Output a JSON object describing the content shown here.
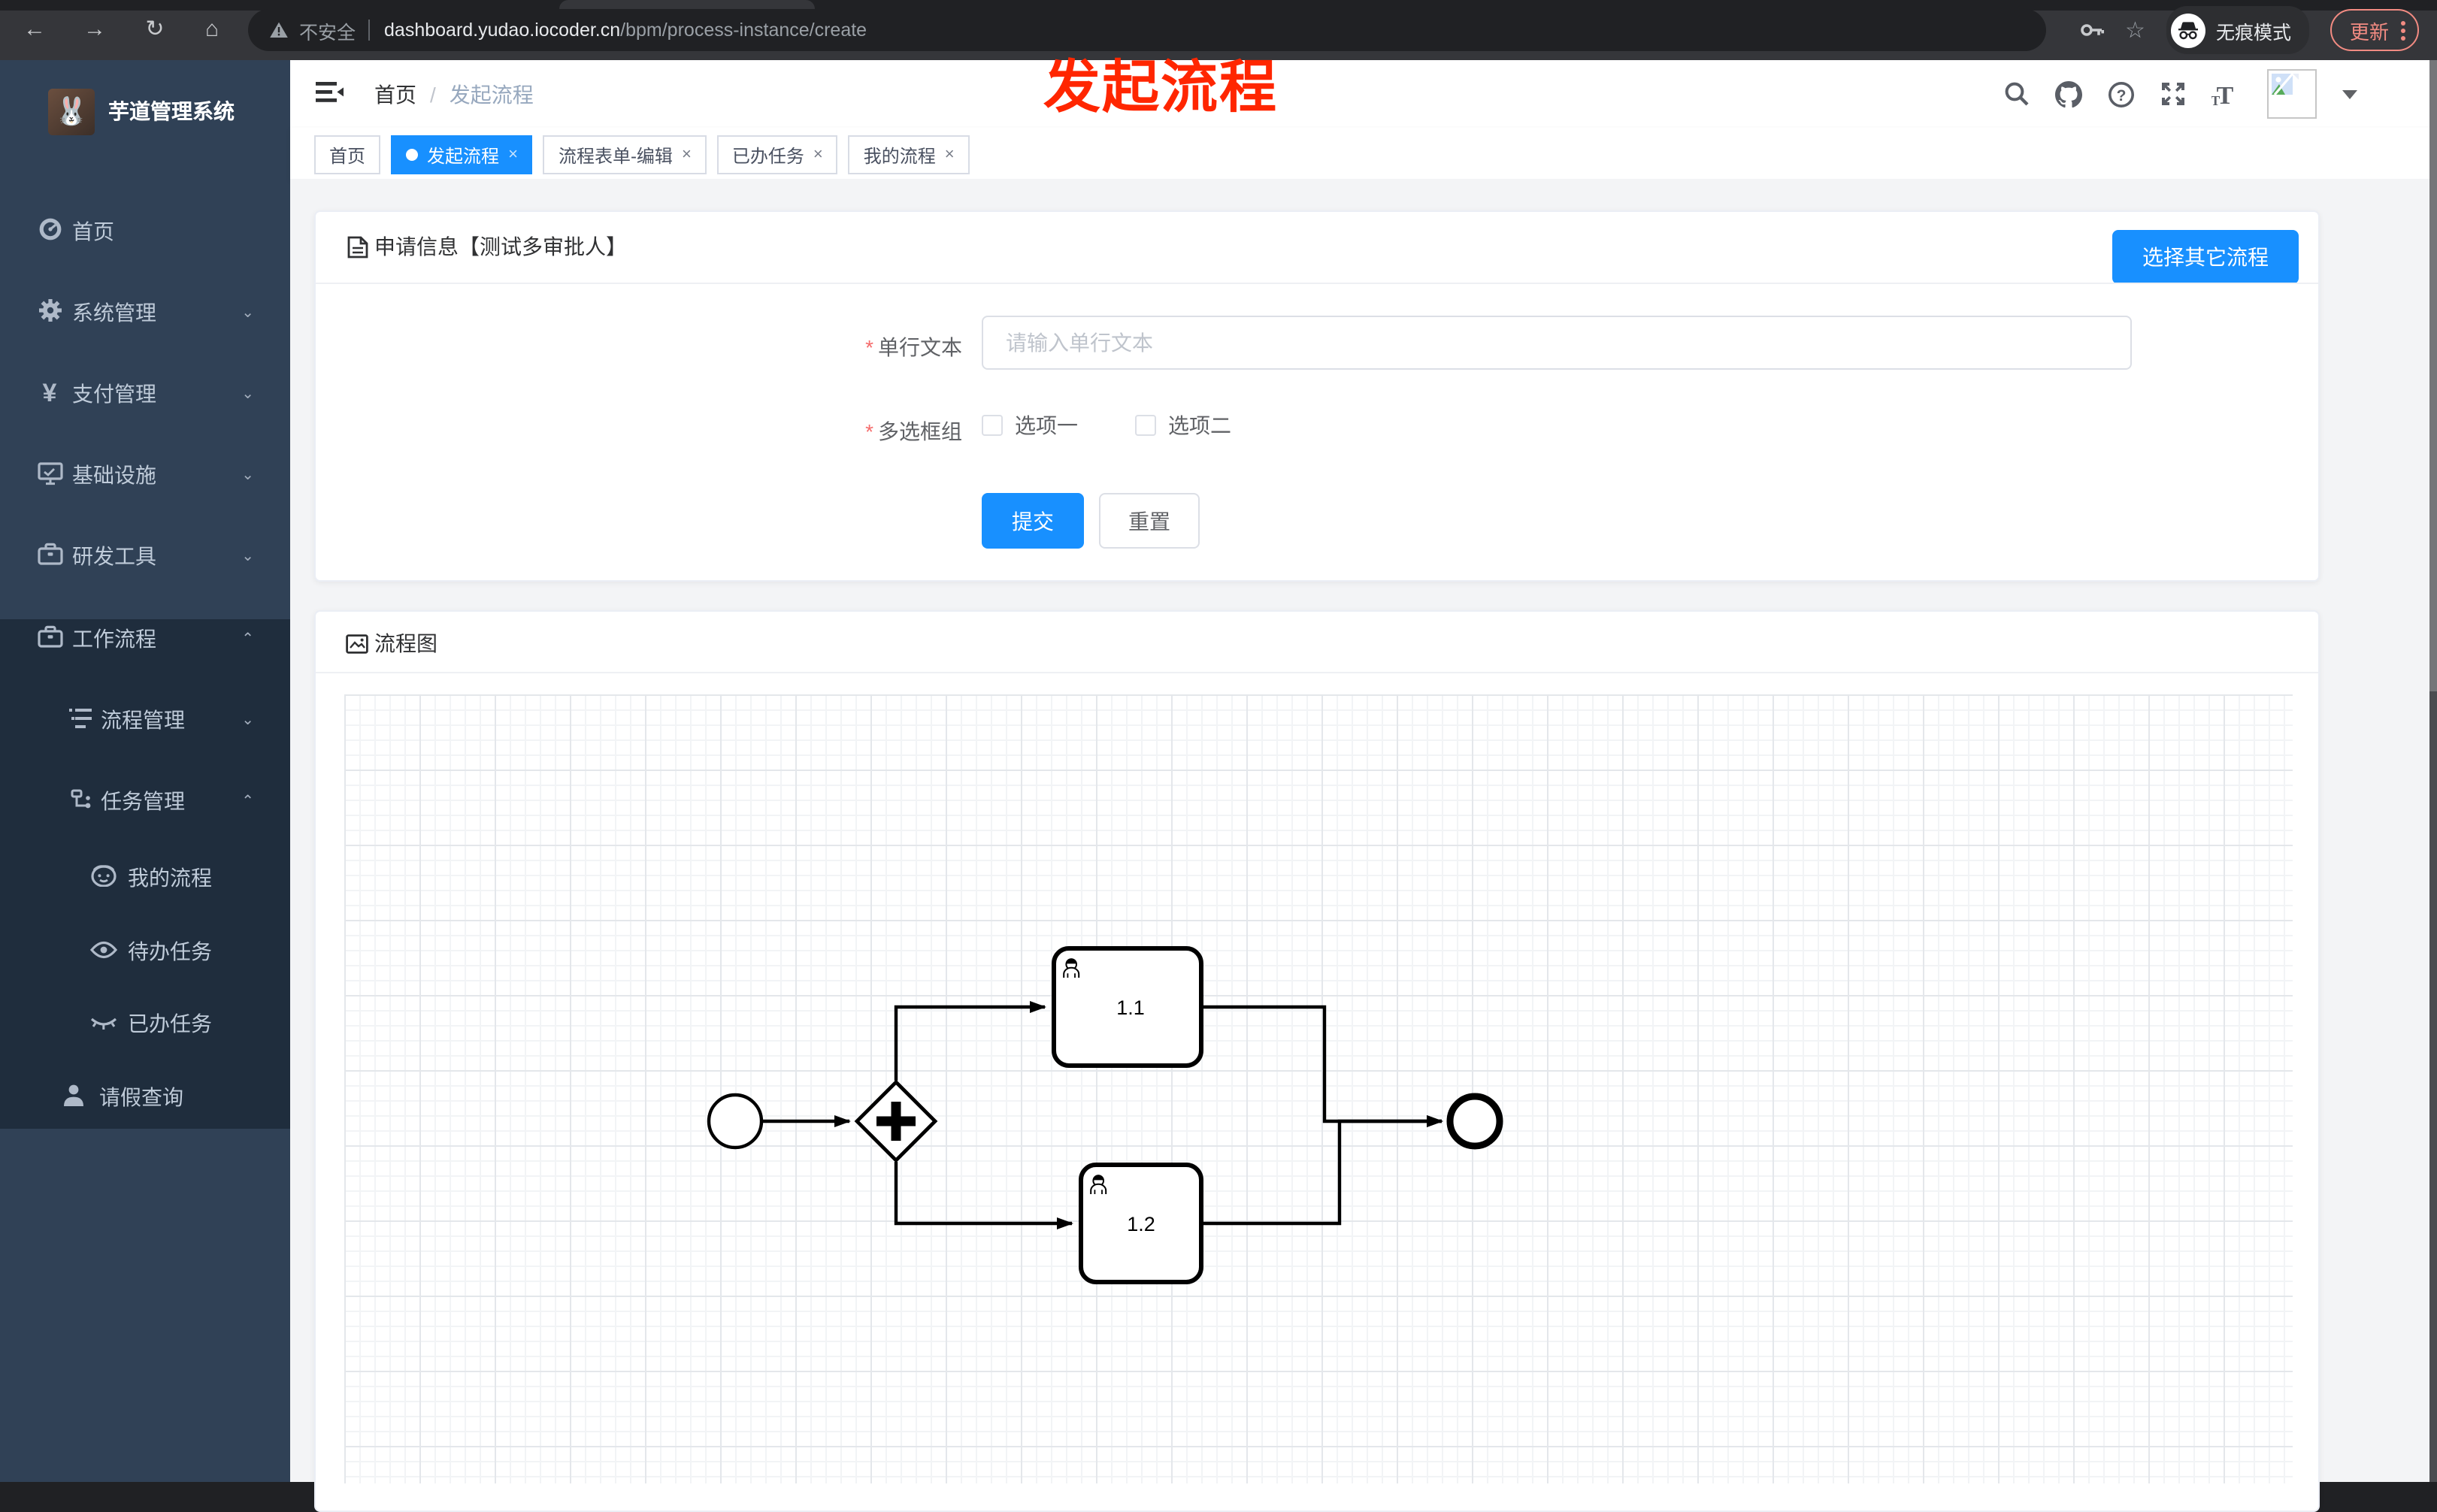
{
  "browser": {
    "security_label": "不安全",
    "url_host": "dashboard.yudao.iocoder.cn",
    "url_path": "/bpm/process-instance/create",
    "incognito_label": "无痕模式",
    "update_label": "更新"
  },
  "annotation": {
    "text": "发起流程"
  },
  "sidebar": {
    "title": "芋道管理系统",
    "items": [
      {
        "label": "首页"
      },
      {
        "label": "系统管理"
      },
      {
        "label": "支付管理"
      },
      {
        "label": "基础设施"
      },
      {
        "label": "研发工具"
      },
      {
        "label": "工作流程"
      },
      {
        "label": "流程管理"
      },
      {
        "label": "任务管理"
      },
      {
        "label": "我的流程"
      },
      {
        "label": "待办任务"
      },
      {
        "label": "已办任务"
      },
      {
        "label": "请假查询"
      }
    ]
  },
  "header": {
    "breadcrumb_home": "首页",
    "breadcrumb_sep": "/",
    "breadcrumb_current": "发起流程"
  },
  "tabs": [
    {
      "label": "首页"
    },
    {
      "label": "发起流程",
      "close": "×"
    },
    {
      "label": "流程表单-编辑",
      "close": "×"
    },
    {
      "label": "已办任务",
      "close": "×"
    },
    {
      "label": "我的流程",
      "close": "×"
    }
  ],
  "form_card": {
    "title": "申请信息【测试多审批人】",
    "choose_button": "选择其它流程",
    "text_field": {
      "label": "单行文本",
      "placeholder": "请输入单行文本"
    },
    "checkbox_group": {
      "label": "多选框组",
      "options": [
        {
          "label": "选项一"
        },
        {
          "label": "选项二"
        }
      ]
    },
    "submit_label": "提交",
    "reset_label": "重置"
  },
  "diagram_card": {
    "title": "流程图",
    "tasks": [
      {
        "label": "1.1"
      },
      {
        "label": "1.2"
      }
    ]
  },
  "colors": {
    "primary": "#1890ff",
    "annotation": "#ff2600",
    "sidebar_bg": "#304156",
    "submenu_bg": "#1f2d3d"
  }
}
